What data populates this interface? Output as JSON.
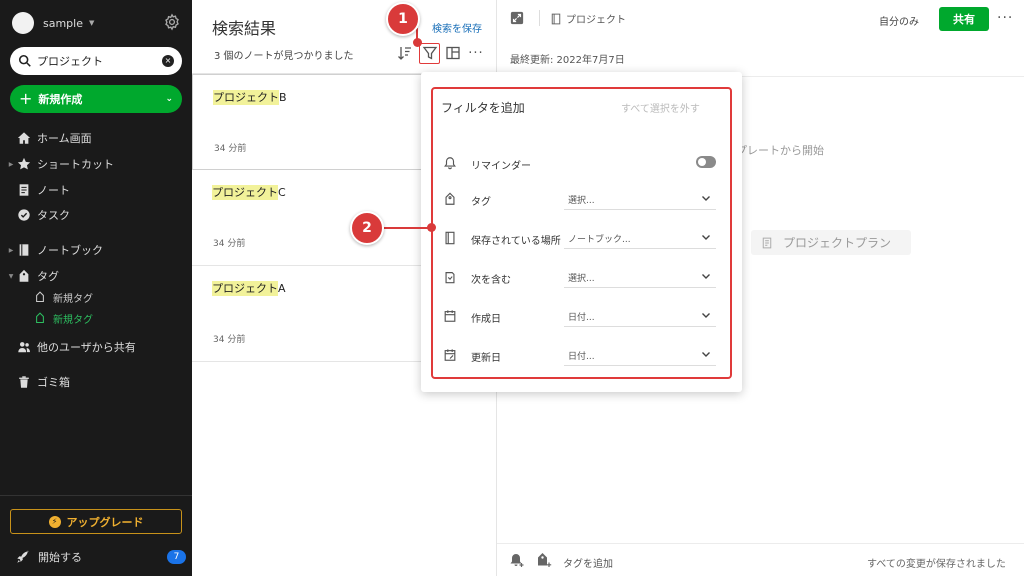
{
  "sidebar": {
    "account_name": "sample",
    "search": {
      "value": "プロジェクト"
    },
    "new_button": "新規作成",
    "nav": {
      "home": "ホーム画面",
      "shortcuts": "ショートカット",
      "notes": "ノート",
      "tasks": "タスク",
      "notebooks": "ノートブック",
      "tags": "タグ",
      "tag_children": [
        "新規タグ",
        "新規タグ"
      ],
      "shared": "他のユーザから共有",
      "trash": "ゴミ箱"
    },
    "upgrade": "アップグレード",
    "get_started": "開始する",
    "get_started_badge": "7"
  },
  "notes_list": {
    "title": "検索結果",
    "save_search": "検索を保存",
    "count_text": "3 個のノートが見つかりました",
    "cards": [
      {
        "highlight": "プロジェクト",
        "rest": "B",
        "time": "34 分前"
      },
      {
        "highlight": "プロジェクト",
        "rest": "C",
        "time": "34 分前"
      },
      {
        "highlight": "プロジェクト",
        "rest": "A",
        "time": "34 分前"
      }
    ]
  },
  "editor": {
    "notebook": "プロジェクト",
    "visibility": "自分のみ",
    "share": "共有",
    "last_updated": "最終更新: 2022年7月7日",
    "template_hint": "プレートから開始",
    "template_item": "プロジェクトプラン",
    "add_tag": "タグを追加",
    "saved_status": "すべての変更が保存されました"
  },
  "filter_popup": {
    "title": "フィルタを追加",
    "clear_all": "すべて選択を外す",
    "reminder": {
      "label": "リマインダー",
      "enabled": false
    },
    "rows": [
      {
        "label": "タグ",
        "value": "選択..."
      },
      {
        "label": "保存されている場所",
        "value": "ノートブック..."
      },
      {
        "label": "次を含む",
        "value": "選択..."
      },
      {
        "label": "作成日",
        "value": "日付..."
      },
      {
        "label": "更新日",
        "value": "日付..."
      }
    ]
  },
  "annotations": {
    "marker_1": "1",
    "marker_2": "2"
  },
  "colors": {
    "accent_green": "#00a82d",
    "annotation_red": "#d93a3a",
    "highlight_yellow": "#f2f29a",
    "sidebar_bg": "#1a1a1a"
  }
}
